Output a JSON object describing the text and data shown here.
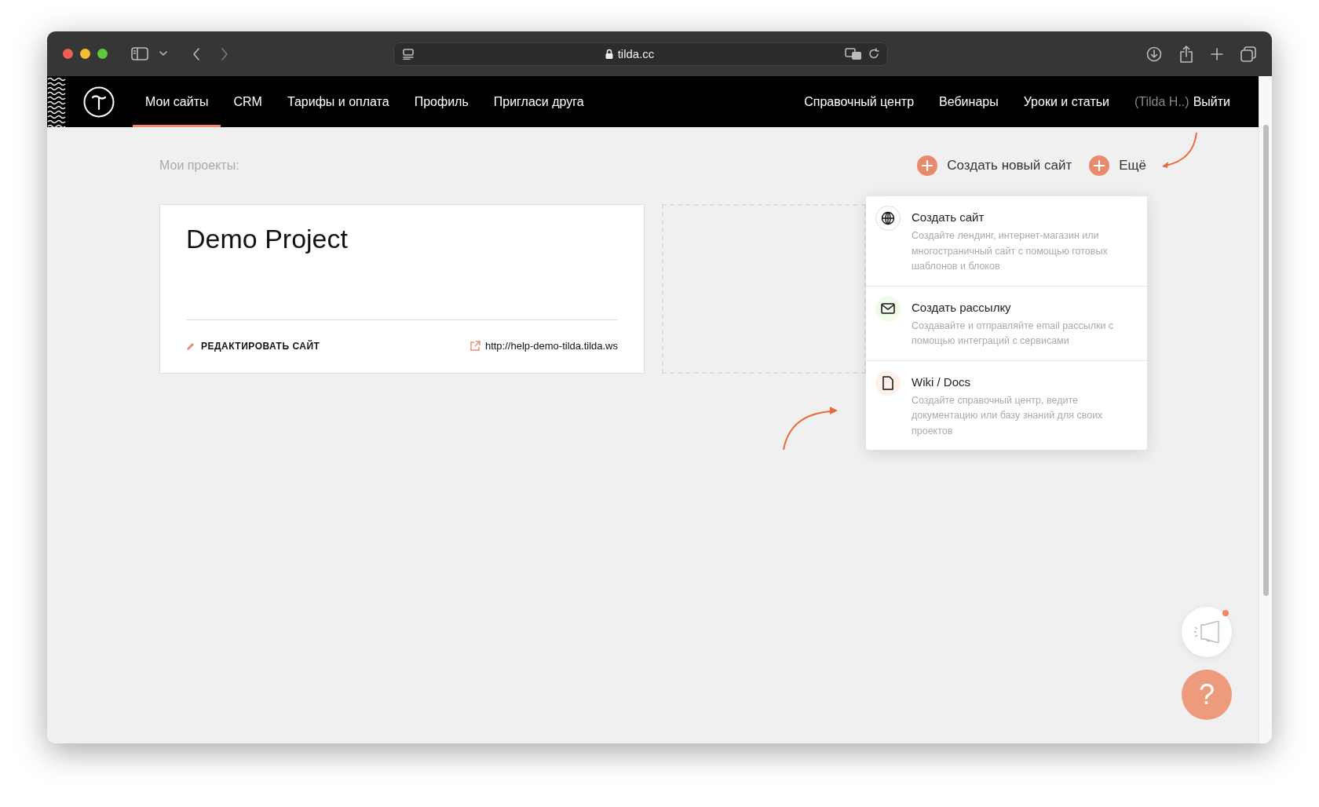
{
  "browser": {
    "address": "tilda.cc"
  },
  "nav": {
    "left": [
      {
        "label": "Мои сайты",
        "selected": true
      },
      {
        "label": "CRM",
        "selected": false
      },
      {
        "label": "Тарифы и оплата",
        "selected": false
      },
      {
        "label": "Профиль",
        "selected": false
      },
      {
        "label": "Пригласи друга",
        "selected": false
      }
    ],
    "right": [
      {
        "label": "Справочный центр"
      },
      {
        "label": "Вебинары"
      },
      {
        "label": "Уроки и статьи"
      }
    ],
    "user": "(Tilda H..)",
    "logout": "Выйти"
  },
  "projects": {
    "heading": "Мои проекты:",
    "create_button": "Создать новый сайт",
    "more_button": "Ещё",
    "cards": [
      {
        "title": "Demo Project",
        "edit_link": "РЕДАКТИРОВАТЬ САЙТ",
        "url": "http://help-demo-tilda.tilda.ws"
      }
    ]
  },
  "menu": {
    "items": [
      {
        "kind": "globe",
        "title": "Создать сайт",
        "description": "Создайте лендинг, интернет-магазин или многостраничный сайт с помощью готовых шаблонов и блоков",
        "color": "#ffffff"
      },
      {
        "kind": "mail",
        "title": "Создать рассылку",
        "description": "Создавайте и отправляйте email рассылки с помощью интеграций с сервисами",
        "color": "#f0fbe9"
      },
      {
        "kind": "doc",
        "title": "Wiki / Docs",
        "description": "Создайте справочный центр, ведите документацию или базу знаний для своих проектов",
        "color": "#fdf1ea"
      }
    ]
  },
  "widgets": {
    "announcements_unread": true,
    "help_label": "?"
  }
}
